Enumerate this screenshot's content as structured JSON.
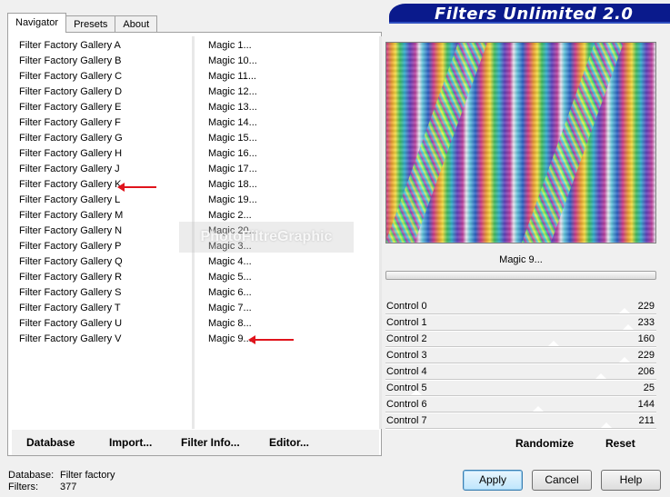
{
  "banner": {
    "title": "Filters Unlimited 2.0"
  },
  "tabs": [
    "Navigator",
    "Presets",
    "About"
  ],
  "categories": [
    "Filter Factory Gallery A",
    "Filter Factory Gallery B",
    "Filter Factory Gallery C",
    "Filter Factory Gallery D",
    "Filter Factory Gallery E",
    "Filter Factory Gallery F",
    "Filter Factory Gallery G",
    "Filter Factory Gallery H",
    "Filter Factory Gallery J",
    "Filter Factory Gallery K",
    "Filter Factory Gallery L",
    "Filter Factory Gallery M",
    "Filter Factory Gallery N",
    "Filter Factory Gallery P",
    "Filter Factory Gallery Q",
    "Filter Factory Gallery R",
    "Filter Factory Gallery S",
    "Filter Factory Gallery T",
    "Filter Factory Gallery U",
    "Filter Factory Gallery V"
  ],
  "filters": [
    "Magic 1...",
    "Magic 10...",
    "Magic 11...",
    "Magic 12...",
    "Magic 13...",
    "Magic 14...",
    "Magic 15...",
    "Magic 16...",
    "Magic 17...",
    "Magic 18...",
    "Magic 19...",
    "Magic 2...",
    "Magic 20...",
    "Magic 3...",
    "Magic 4...",
    "Magic 5...",
    "Magic 6...",
    "Magic 7...",
    "Magic 8...",
    "Magic 9..."
  ],
  "watermark": "PhotoFiltreGraphic",
  "toolbar": {
    "database": "Database",
    "import": "Import...",
    "filter_info": "Filter Info...",
    "editor": "Editor..."
  },
  "selected_filter": "Magic 9...",
  "controls": [
    {
      "label": "Control 0",
      "value": "229"
    },
    {
      "label": "Control 1",
      "value": "233"
    },
    {
      "label": "Control 2",
      "value": "160"
    },
    {
      "label": "Control 3",
      "value": "229"
    },
    {
      "label": "Control 4",
      "value": "206"
    },
    {
      "label": "Control 5",
      "value": "25"
    },
    {
      "label": "Control 6",
      "value": "144"
    },
    {
      "label": "Control 7",
      "value": "211"
    }
  ],
  "right_buttons": {
    "randomize": "Randomize",
    "reset": "Reset"
  },
  "status": {
    "database_label": "Database:",
    "database_value": "Filter factory",
    "filters_label": "Filters:",
    "filters_value": "377"
  },
  "buttons": {
    "apply": "Apply",
    "cancel": "Cancel",
    "help": "Help"
  }
}
